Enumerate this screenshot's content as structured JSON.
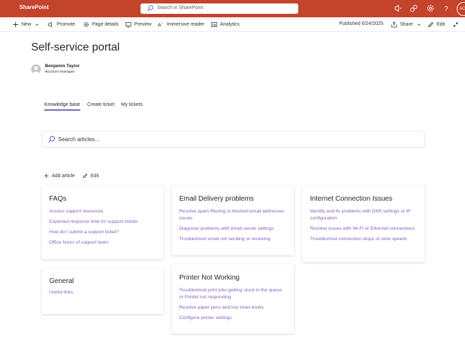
{
  "suite": {
    "brand": "SharePoint",
    "search_placeholder": "Search in SharePoint",
    "avatar_initials": "AC"
  },
  "commands": {
    "new": "New",
    "promote": "Promote",
    "page_details": "Page details",
    "preview": "Preview",
    "immersive_reader": "Immersive reader",
    "analytics": "Analytics",
    "published": "Published 6/24/2025",
    "share": "Share",
    "edit": "Edit"
  },
  "page": {
    "title": "Self-service portal",
    "author_name": "Benjamin Taylor",
    "author_role": "Account manager"
  },
  "tabs": [
    "Knowledge base",
    "Create ticket",
    "My tickets"
  ],
  "search": {
    "placeholder": "Search articles..."
  },
  "toolbar": {
    "add_article": "Add article",
    "edit": "Edit"
  },
  "colors": {
    "suitebar": "#c4432b",
    "accent": "#7f5fbf"
  },
  "cards": [
    {
      "title": "FAQs",
      "links": [
        "Access support resources",
        "Expected response time for support tickets",
        "How do I submit a support ticket?",
        "Office hours of support team"
      ]
    },
    {
      "title": "Email Delivery problems",
      "links": [
        "Resolve spam filtering or blocked email addresses issues",
        "Diagnose problems with email server settings",
        "Troubleshoot email not sending or receiving"
      ]
    },
    {
      "title": "Internet Connection Issues",
      "links": [
        "Identify and fix problems with DNS settings or IP configuration",
        "Resolve issues with Wi-Fi or Ethernet connections",
        "Troubleshoot connection drops or slow speeds"
      ]
    },
    {
      "title": "General",
      "links": [
        "Useful links"
      ]
    },
    {
      "title": "Printer Not Working",
      "links": [
        "Troubleshoot print jobs getting stuck in the queue or Printer not responding",
        "Resolve paper jams and low toner levels",
        "Configure printer settings"
      ]
    }
  ]
}
